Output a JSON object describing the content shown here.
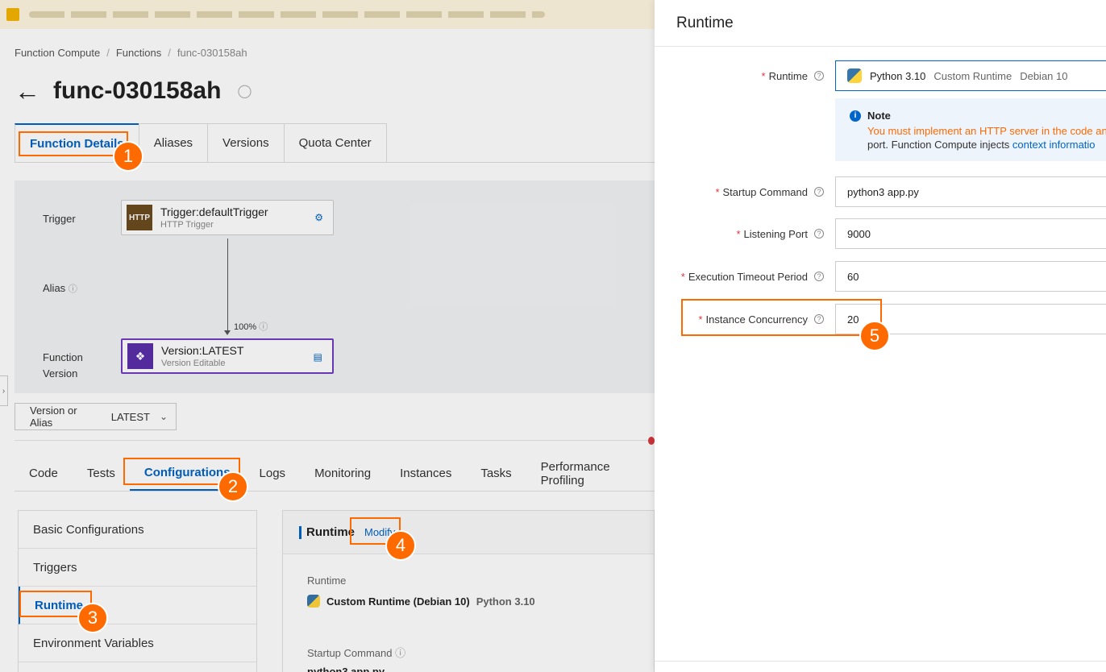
{
  "breadcrumb": [
    "Function Compute",
    "Functions",
    "func-030158ah"
  ],
  "page": {
    "title": "func-030158ah"
  },
  "top_tabs": [
    "Function Details",
    "Aliases",
    "Versions",
    "Quota Center"
  ],
  "diagram": {
    "row_labels": {
      "trigger": "Trigger",
      "alias": "Alias",
      "function": "Function",
      "version": "Version"
    },
    "trigger_node": {
      "icon_text": "HTTP",
      "title": "Trigger:defaultTrigger",
      "subtitle": "HTTP Trigger"
    },
    "version_node": {
      "title": "Version:LATEST",
      "subtitle": "Version Editable"
    },
    "traffic": "100%"
  },
  "version_select": {
    "label": "Version or Alias",
    "value": "LATEST"
  },
  "sub_tabs": [
    "Code",
    "Tests",
    "Configurations",
    "Logs",
    "Monitoring",
    "Instances",
    "Tasks",
    "Performance Profiling"
  ],
  "side_menu": [
    "Basic Configurations",
    "Triggers",
    "Runtime",
    "Environment Variables"
  ],
  "panel": {
    "title": "Runtime",
    "modify": "Modify",
    "runtime_label": "Runtime",
    "runtime_value": "Custom Runtime (Debian 10)",
    "runtime_version": "Python 3.10",
    "startup_label": "Startup Command",
    "startup_value": "python3 app.py"
  },
  "drawer": {
    "title": "Runtime",
    "runtime": {
      "label": "Runtime",
      "value": "Python 3.10",
      "type": "Custom Runtime",
      "os": "Debian 10"
    },
    "note": {
      "title": "Note",
      "line1": "You must implement an HTTP server in the code an",
      "line2_prefix": "port. Function Compute injects ",
      "line2_link": "context informatio"
    },
    "startup": {
      "label": "Startup Command",
      "value": "python3 app.py"
    },
    "port": {
      "label": "Listening Port",
      "value": "9000"
    },
    "timeout": {
      "label": "Execution Timeout Period",
      "value": "60"
    },
    "concurrency": {
      "label": "Instance Concurrency",
      "value": "20"
    }
  },
  "callouts": [
    "1",
    "2",
    "3",
    "4",
    "5"
  ],
  "colors": {
    "accent": "#0064c8",
    "callout": "#ff6a00",
    "required": "#d9363e"
  }
}
